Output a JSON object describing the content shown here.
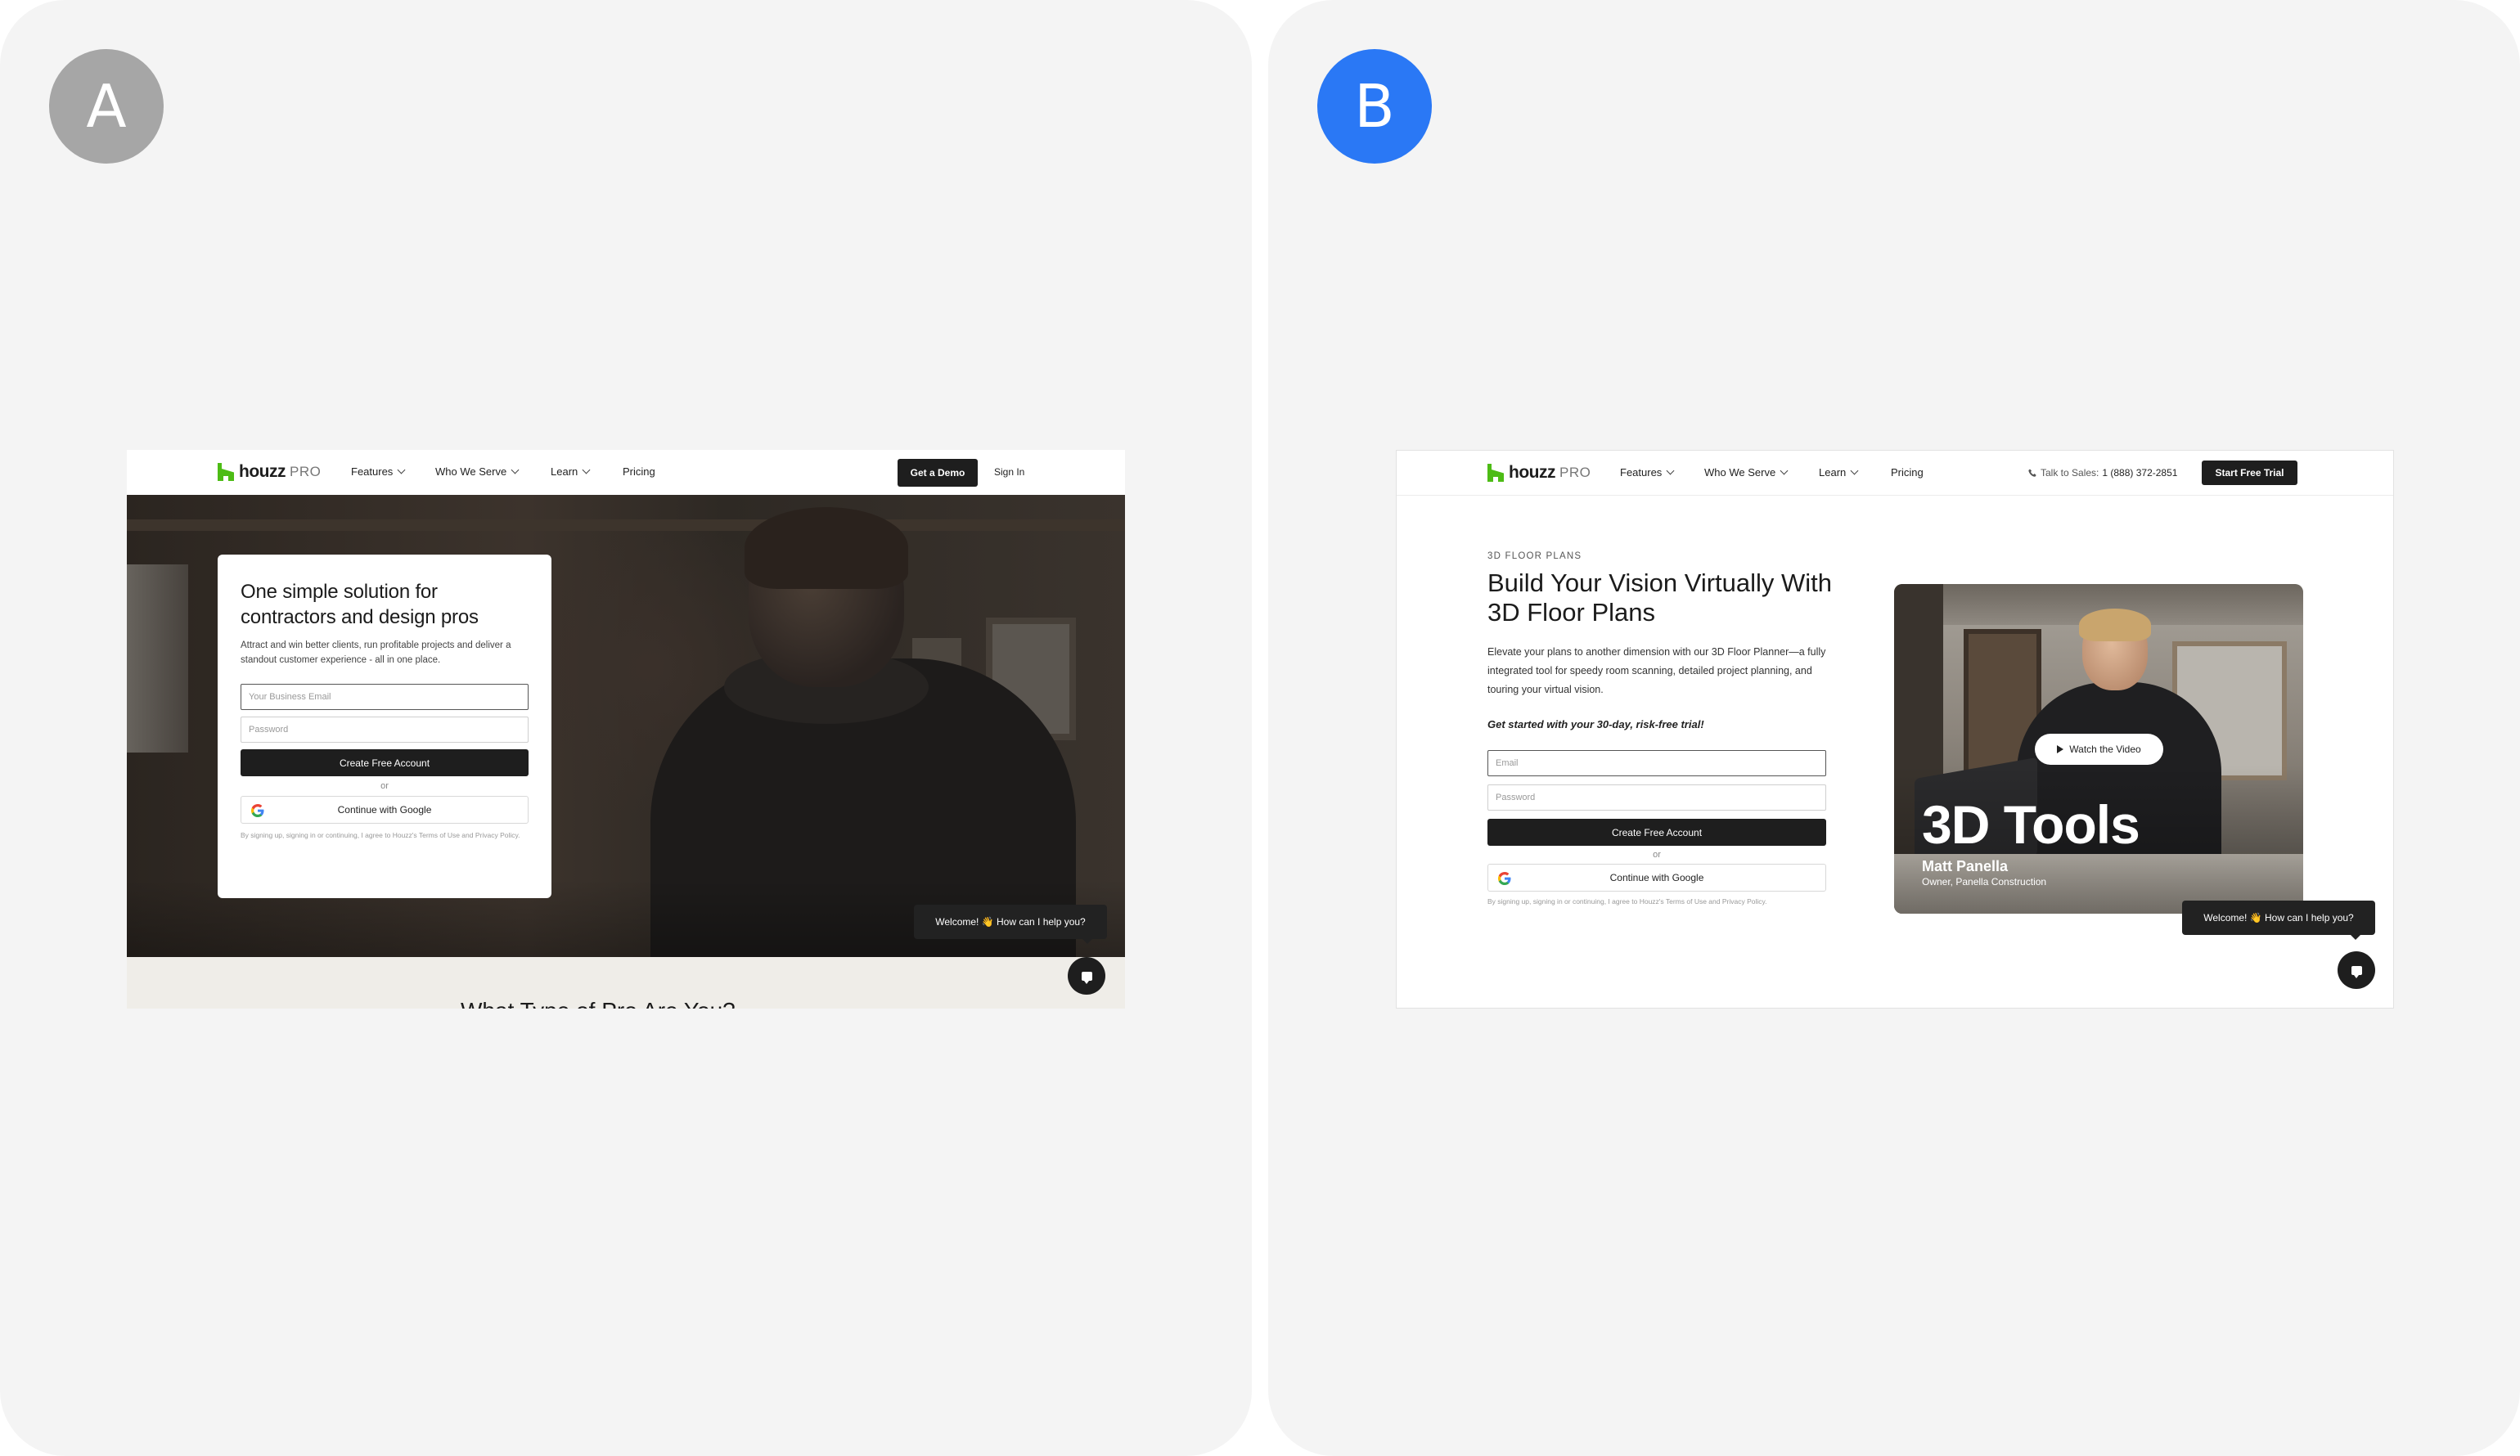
{
  "panel_a": {
    "badge": "A",
    "nav": {
      "logo_word": "houzz",
      "logo_pro": "PRO",
      "features": "Features",
      "who_we_serve": "Who We Serve",
      "learn": "Learn",
      "pricing": "Pricing",
      "get_demo": "Get a Demo",
      "sign_in": "Sign In"
    },
    "card": {
      "title": "One simple solution for contractors and design pros",
      "subtitle": "Attract and win better clients, run profitable projects and deliver a standout customer experience - all in one place.",
      "email_placeholder": "Your Business Email",
      "password_placeholder": "Password",
      "create_button": "Create Free Account",
      "or": "or",
      "google_button": "Continue with Google",
      "legal": "By signing up, signing in or continuing, I agree to Houzz's Terms of Use and Privacy Policy."
    },
    "next_section_heading": "What Type of Pro Are You?",
    "chat": {
      "bubble": "Welcome! 👋 How can I help you?"
    }
  },
  "panel_b": {
    "badge": "B",
    "nav": {
      "logo_word": "houzz",
      "logo_pro": "PRO",
      "features": "Features",
      "who_we_serve": "Who We Serve",
      "learn": "Learn",
      "pricing": "Pricing",
      "talk_to_sales": "Talk to Sales:",
      "phone": "1 (888) 372-2851",
      "start_trial": "Start Free Trial"
    },
    "eyebrow": "3D FLOOR PLANS",
    "title": "Build Your Vision Virtually With 3D Floor Plans",
    "description": "Elevate your plans to another dimension with our 3D Floor Planner—a fully integrated tool for speedy room scanning, detailed project planning, and touring your virtual vision.",
    "cta_text": "Get started with your 30-day, risk-free trial!",
    "form": {
      "email_placeholder": "Email",
      "password_placeholder": "Password",
      "create_button": "Create Free Account",
      "or": "or",
      "google_button": "Continue with Google",
      "legal": "By signing up, signing in or continuing, I agree to Houzz's Terms of Use and Privacy Policy."
    },
    "video": {
      "watch_button": "Watch the Video",
      "title": "3D Tools",
      "person_name": "Matt Panella",
      "person_role": "Owner, Panella Construction"
    },
    "chat": {
      "bubble": "Welcome! 👋 How can I help you?"
    }
  },
  "colors": {
    "brand_green": "#4dbc15",
    "dark_button": "#1e1e1e",
    "badge_a": "#a6a6a6",
    "badge_b": "#2a78f5"
  }
}
